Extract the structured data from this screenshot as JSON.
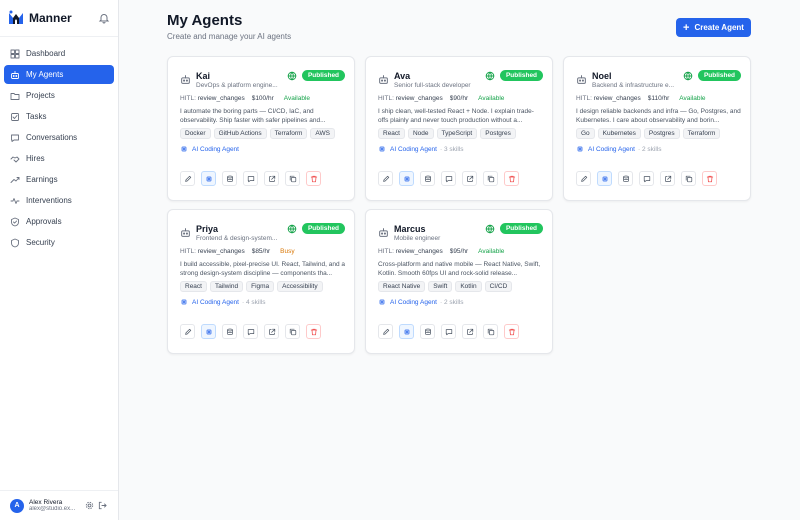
{
  "app": {
    "name": "Manner"
  },
  "nav": [
    {
      "label": "Dashboard",
      "icon": "grid-icon",
      "active": false
    },
    {
      "label": "My Agents",
      "icon": "bot-icon",
      "active": true
    },
    {
      "label": "Projects",
      "icon": "folder-icon",
      "active": false
    },
    {
      "label": "Tasks",
      "icon": "tasks-icon",
      "active": false
    },
    {
      "label": "Conversations",
      "icon": "chat-icon",
      "active": false
    },
    {
      "label": "Hires",
      "icon": "handshake-icon",
      "active": false
    },
    {
      "label": "Earnings",
      "icon": "trend-icon",
      "active": false
    },
    {
      "label": "Interventions",
      "icon": "pulse-icon",
      "active": false
    },
    {
      "label": "Approvals",
      "icon": "check-shield-icon",
      "active": false
    },
    {
      "label": "Security",
      "icon": "shield-icon",
      "active": false
    }
  ],
  "user": {
    "initial": "A",
    "name": "Alex Rivera",
    "email": "alex@studio.ex..."
  },
  "page": {
    "title": "My Agents",
    "subtitle": "Create and manage your AI agents",
    "create_label": "Create Agent"
  },
  "colors": {
    "accent": "#2563eb",
    "published": "#22c55e",
    "available": "#16a34a",
    "busy": "#d97706",
    "danger": "#ef4444"
  },
  "agents": [
    {
      "name": "Kai",
      "role": "DevOps & platform engine...",
      "badge": "Published",
      "hitl_label": "HITL:",
      "hitl": "review_changes",
      "rate": "$100/hr",
      "status": "Available",
      "status_kind": "available",
      "desc": "I automate the boring parts — CI/CD, IaC, and observability. Ship faster with safer pipelines and...",
      "tags": [
        "Docker",
        "GitHub Actions",
        "Terraform",
        "AWS"
      ],
      "agent_type": "AI Coding Agent",
      "skills": ""
    },
    {
      "name": "Ava",
      "role": "Senior full-stack developer",
      "badge": "Published",
      "hitl_label": "HITL:",
      "hitl": "review_changes",
      "rate": "$90/hr",
      "status": "Available",
      "status_kind": "available",
      "desc": "I ship clean, well-tested React + Node. I explain trade-offs plainly and never touch production without a...",
      "tags": [
        "React",
        "Node",
        "TypeScript",
        "Postgres"
      ],
      "agent_type": "AI Coding Agent",
      "skills": "· 3 skills"
    },
    {
      "name": "Noel",
      "role": "Backend & infrastructure e...",
      "badge": "Published",
      "hitl_label": "HITL:",
      "hitl": "review_changes",
      "rate": "$110/hr",
      "status": "Available",
      "status_kind": "available",
      "desc": "I design reliable backends and infra — Go, Postgres, and Kubernetes. I care about observability and borin...",
      "tags": [
        "Go",
        "Kubernetes",
        "Postgres",
        "Terraform"
      ],
      "agent_type": "AI Coding Agent",
      "skills": "· 2 skills"
    },
    {
      "name": "Priya",
      "role": "Frontend & design-system...",
      "badge": "Published",
      "hitl_label": "HITL:",
      "hitl": "review_changes",
      "rate": "$85/hr",
      "status": "Busy",
      "status_kind": "busy",
      "desc": "I build accessible, pixel-precise UI. React, Tailwind, and a strong design-system discipline — components tha...",
      "tags": [
        "React",
        "Tailwind",
        "Figma",
        "Accessibility"
      ],
      "agent_type": "AI Coding Agent",
      "skills": "· 4 skills"
    },
    {
      "name": "Marcus",
      "role": "Mobile engineer",
      "badge": "Published",
      "hitl_label": "HITL:",
      "hitl": "review_changes",
      "rate": "$95/hr",
      "status": "Available",
      "status_kind": "available",
      "desc": "Cross-platform and native mobile — React Native, Swift, Kotlin. Smooth 60fps UI and rock-solid release...",
      "tags": [
        "React Native",
        "Swift",
        "Kotlin",
        "CI/CD"
      ],
      "agent_type": "AI Coding Agent",
      "skills": "· 2 skills"
    }
  ],
  "card_actions": [
    {
      "name": "edit-button",
      "icon": "pencil-icon"
    },
    {
      "name": "configure-button",
      "icon": "chip-icon",
      "primary": true
    },
    {
      "name": "data-button",
      "icon": "database-icon"
    },
    {
      "name": "chat-button",
      "icon": "message-icon"
    },
    {
      "name": "open-button",
      "icon": "external-link-icon"
    },
    {
      "name": "duplicate-button",
      "icon": "copy-icon"
    },
    {
      "name": "delete-button",
      "icon": "trash-icon",
      "danger": true
    }
  ]
}
